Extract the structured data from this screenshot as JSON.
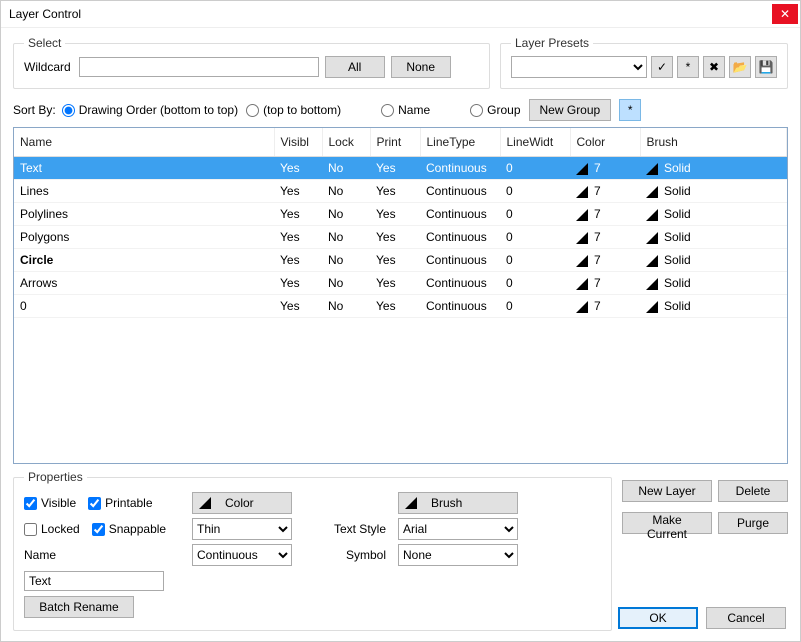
{
  "window": {
    "title": "Layer Control"
  },
  "select": {
    "legend": "Select",
    "wildcard_label": "Wildcard",
    "wildcard_value": "",
    "all_label": "All",
    "none_label": "None"
  },
  "presets": {
    "legend": "Layer Presets",
    "selected": "",
    "icons": {
      "check": "✓",
      "asterisk": "*",
      "delete": "✖",
      "open": "📂",
      "save": "💾"
    }
  },
  "sort": {
    "label": "Sort By:",
    "opts": {
      "drawing_order_btt": "Drawing Order (bottom to top)",
      "ttb": "(top to bottom)",
      "name": "Name",
      "group": "Group"
    },
    "selected": "drawing_order_btt",
    "new_group_label": "New Group",
    "extra_glyph": "*"
  },
  "table": {
    "columns": [
      "Name",
      "Visibl",
      "Lock",
      "Print",
      "LineType",
      "LineWidt",
      "Color",
      "Brush"
    ],
    "rows": [
      {
        "name": "Text",
        "visible": "Yes",
        "lock": "No",
        "print": "Yes",
        "linetype": "Continuous",
        "linewidth": "0",
        "color": "7",
        "brush": "Solid",
        "selected": true,
        "current": false
      },
      {
        "name": "Lines",
        "visible": "Yes",
        "lock": "No",
        "print": "Yes",
        "linetype": "Continuous",
        "linewidth": "0",
        "color": "7",
        "brush": "Solid",
        "selected": false,
        "current": false
      },
      {
        "name": "Polylines",
        "visible": "Yes",
        "lock": "No",
        "print": "Yes",
        "linetype": "Continuous",
        "linewidth": "0",
        "color": "7",
        "brush": "Solid",
        "selected": false,
        "current": false
      },
      {
        "name": "Polygons",
        "visible": "Yes",
        "lock": "No",
        "print": "Yes",
        "linetype": "Continuous",
        "linewidth": "0",
        "color": "7",
        "brush": "Solid",
        "selected": false,
        "current": false
      },
      {
        "name": "Circle",
        "visible": "Yes",
        "lock": "No",
        "print": "Yes",
        "linetype": "Continuous",
        "linewidth": "0",
        "color": "7",
        "brush": "Solid",
        "selected": false,
        "current": true
      },
      {
        "name": "Arrows",
        "visible": "Yes",
        "lock": "No",
        "print": "Yes",
        "linetype": "Continuous",
        "linewidth": "0",
        "color": "7",
        "brush": "Solid",
        "selected": false,
        "current": false
      },
      {
        "name": "0",
        "visible": "Yes",
        "lock": "No",
        "print": "Yes",
        "linetype": "Continuous",
        "linewidth": "0",
        "color": "7",
        "brush": "Solid",
        "selected": false,
        "current": false
      }
    ]
  },
  "properties": {
    "legend": "Properties",
    "checks": {
      "visible": {
        "label": "Visible",
        "checked": true
      },
      "printable": {
        "label": "Printable",
        "checked": true
      },
      "locked": {
        "label": "Locked",
        "checked": false
      },
      "snappable": {
        "label": "Snappable",
        "checked": true
      }
    },
    "name_label": "Name",
    "name_value": "Text",
    "batch_rename_label": "Batch Rename",
    "color_label": "Color",
    "brush_label": "Brush",
    "thin_value": "Thin",
    "continuous_value": "Continuous",
    "text_style_label": "Text Style",
    "text_style_value": "Arial",
    "symbol_label": "Symbol",
    "symbol_value": "None"
  },
  "side": {
    "new_layer": "New Layer",
    "delete": "Delete",
    "make_current": "Make Current",
    "purge": "Purge"
  },
  "footer": {
    "ok": "OK",
    "cancel": "Cancel"
  }
}
